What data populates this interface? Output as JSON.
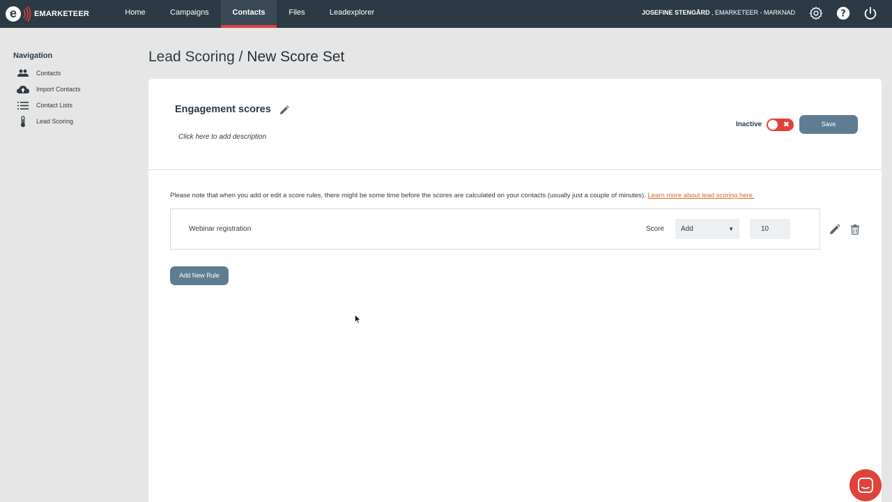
{
  "app": {
    "logo_letter": "e",
    "logo_text": "EMARKETEER",
    "accent_color": "#e0433b",
    "topbar_color": "#2b3a44",
    "link_color": "#d4682a"
  },
  "topnav": {
    "tabs": [
      {
        "label": "Home"
      },
      {
        "label": "Campaigns"
      },
      {
        "label": "Contacts",
        "active": true
      },
      {
        "label": "Files"
      },
      {
        "label": "Leadexplorer"
      }
    ],
    "user_name": "JOSEFINE STENGÅRD",
    "user_org": " , EMARKETEER - MARKNAD",
    "icons": [
      "gear-icon",
      "help-icon",
      "power-icon"
    ]
  },
  "sidebar": {
    "title": "Navigation",
    "items": [
      {
        "label": "Contacts",
        "icon": "people-icon"
      },
      {
        "label": "Import Contacts",
        "icon": "cloud-upload-icon"
      },
      {
        "label": "Contact Lists",
        "icon": "list-icon"
      },
      {
        "label": "Lead Scoring",
        "icon": "thermometer-icon"
      }
    ]
  },
  "page": {
    "breadcrumb": "Lead Scoring",
    "separator": " / ",
    "title": "New Score Set"
  },
  "score_set": {
    "name": "Engagement scores",
    "description_placeholder": "Click here to add description",
    "status_label": "Inactive",
    "active": false,
    "toggle_mark": "✖",
    "save_label": "Save"
  },
  "rules_section": {
    "note": "Please note that when you add or edit a score rules, there might be some time before the scores are calculated on your contacts (usually just a couple of minutes). ",
    "note_link": "Learn more about lead scoring here.",
    "rules": [
      {
        "name": "Webinar registration",
        "score_label": "Score",
        "operation": "Add",
        "caret": "▼",
        "value": "10"
      }
    ],
    "add_rule_label": "Add New Rule"
  }
}
